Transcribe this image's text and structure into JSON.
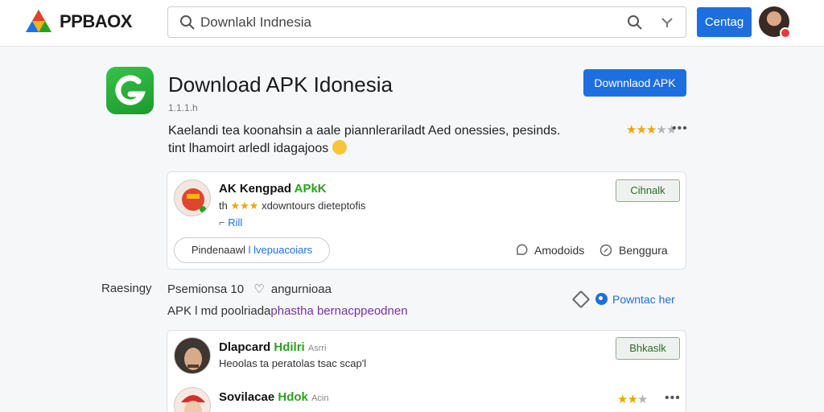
{
  "header": {
    "brand": "PPBAOX",
    "search": {
      "value": "Downlakl Indnesia",
      "placeholder": "Downlakl Indnesia"
    },
    "button_label": "Centag"
  },
  "app": {
    "title": "Download APK Idonesia",
    "subtitle": "1.1.1.h",
    "download_label": "Downnlaod APK",
    "description_line1": "Kaelandi tea koonahsin a aale piannlerariladt Aed onessies, pesinds.",
    "description_line2": "tint lhamoirt arledl idagajoos",
    "rating": {
      "value": 3,
      "max": 5
    }
  },
  "card1": {
    "title": "AK Kengpad",
    "title_accent": "APkK",
    "meta_prefix": "th",
    "meta_stars": "★★★",
    "meta_text": "xdowntours dieteptofis",
    "link_prefix": "⌐",
    "link": "Rill",
    "button_label": "Cihnalk",
    "pill_label": "Pindenaawl",
    "pill_accent": "l lvepuacoiars",
    "action1": "Amodoids",
    "action2": "Benggura"
  },
  "section": {
    "label": "Raesingy",
    "text1": "Psemionsa 10",
    "text1_b": "angurnioaa",
    "line_prefix": "APK l md poolriada",
    "line_accent": "phastha bernacppeodnen",
    "button_label": "Powntac her"
  },
  "card2": {
    "row1": {
      "name": "Dlapcard",
      "name_accent": "Hdilri",
      "name_small": "Asrri",
      "meta": "Heoolas ta peratolas tsac scap'l",
      "button_label": "Bhkaslk"
    },
    "row2": {
      "name": "Sovilacae",
      "name_accent": "Hdok",
      "name_small": "Acin",
      "rating": {
        "value": 1.5,
        "max": 3
      }
    }
  },
  "colors": {
    "accent_blue": "#1d6fe0",
    "accent_green": "#2aa11f",
    "star": "#e9a800"
  },
  "icons": [
    "logo-icon",
    "search-icon",
    "clear-icon",
    "app-icon",
    "star-icon",
    "more-icon",
    "avatar",
    "diamond-icon",
    "heart-icon",
    "comment-icon",
    "edit-icon",
    "power-icon"
  ]
}
